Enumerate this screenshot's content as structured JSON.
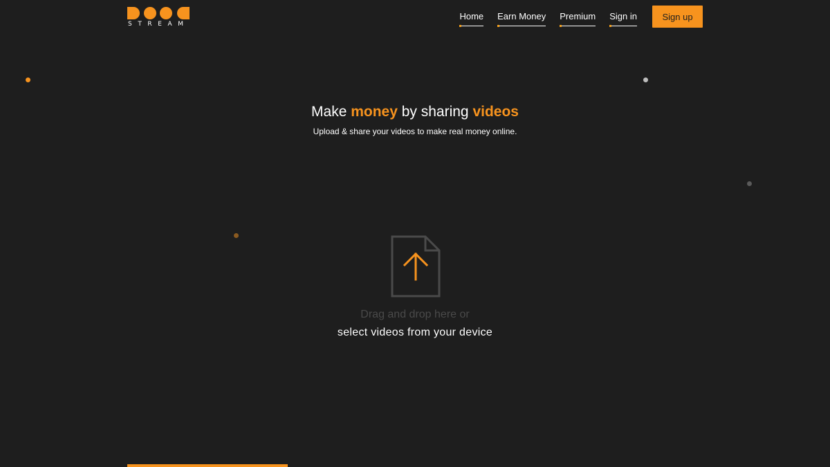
{
  "brand": {
    "logo_text": "STREAM",
    "accent_color": "#f7931e",
    "background_color": "#1e1e1e"
  },
  "nav": {
    "items": [
      {
        "label": "Home"
      },
      {
        "label": "Earn Money"
      },
      {
        "label": "Premium"
      },
      {
        "label": "Sign in"
      }
    ],
    "signup_label": "Sign up"
  },
  "hero": {
    "title_part1": "Make ",
    "title_accent1": "money",
    "title_part2": " by sharing ",
    "title_accent2": "videos",
    "subtitle": "Upload & share your videos to make real money online."
  },
  "upload": {
    "icon": "file-upload-icon",
    "drag_text": "Drag and drop here or",
    "select_text": "select videos from your device"
  }
}
